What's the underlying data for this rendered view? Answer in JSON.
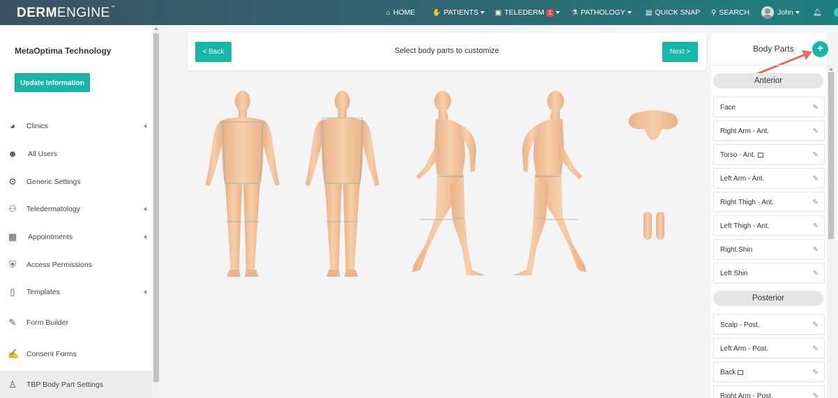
{
  "brand": {
    "name_bold": "DERM",
    "name_light": "ENGINE",
    "tm": "™"
  },
  "nav": {
    "home": "HOME",
    "patients": "PATIENTS",
    "telederm": "TELEDERM",
    "telederm_badge": "1",
    "pathology": "PATHOLOGY",
    "quick_snap": "QUICK SNAP",
    "search": "SEARCH",
    "user": "John"
  },
  "sidebar": {
    "company": "MetaOptima Technology",
    "update_button": "Update Information",
    "items": [
      {
        "label": "Clinics",
        "icon": "pie-chart-icon",
        "has_arrow": true
      },
      {
        "label": "All Users",
        "icon": "users-icon",
        "has_arrow": false
      },
      {
        "label": "Generic Settings",
        "icon": "gear-icon",
        "has_arrow": false
      },
      {
        "label": "Teledermatology",
        "icon": "teledermatology-icon",
        "has_arrow": true
      },
      {
        "label": "Appointments",
        "icon": "calendar-icon",
        "has_arrow": true
      },
      {
        "label": "Access Permissions",
        "icon": "shield-lock-icon",
        "has_arrow": false
      },
      {
        "label": "Templates",
        "icon": "document-icon",
        "has_arrow": true
      },
      {
        "label": "Form Builder",
        "icon": "form-edit-icon",
        "has_arrow": false
      },
      {
        "label": "Consent Forms",
        "icon": "consent-icon",
        "has_arrow": false
      },
      {
        "label": "TBP Body Part Settings",
        "icon": "body-figure-icon",
        "has_arrow": false
      }
    ]
  },
  "main": {
    "back_button": "< Back",
    "title": "Select body parts to customize",
    "next_button": "Next >"
  },
  "body_parts": {
    "title": "Body Parts",
    "add_button": "+",
    "anterior_label": "Anterior",
    "anterior": [
      "Face",
      "Right Arm - Ant.",
      "Torso - Ant.",
      "Left Arm - Ant.",
      "Right Thigh - Ant.",
      "Left Thigh - Ant.",
      "Right Shin",
      "Left Shin"
    ],
    "posterior_label": "Posterior",
    "posterior": [
      "Scalp - Post.",
      "Left Arm - Post.",
      "Back",
      "Right Arm - Post."
    ]
  },
  "colors": {
    "accent": "#17b6a9",
    "skin": "#f2c49c",
    "skin_shadow": "#e2a77c",
    "arrow": "#e86a5a"
  }
}
